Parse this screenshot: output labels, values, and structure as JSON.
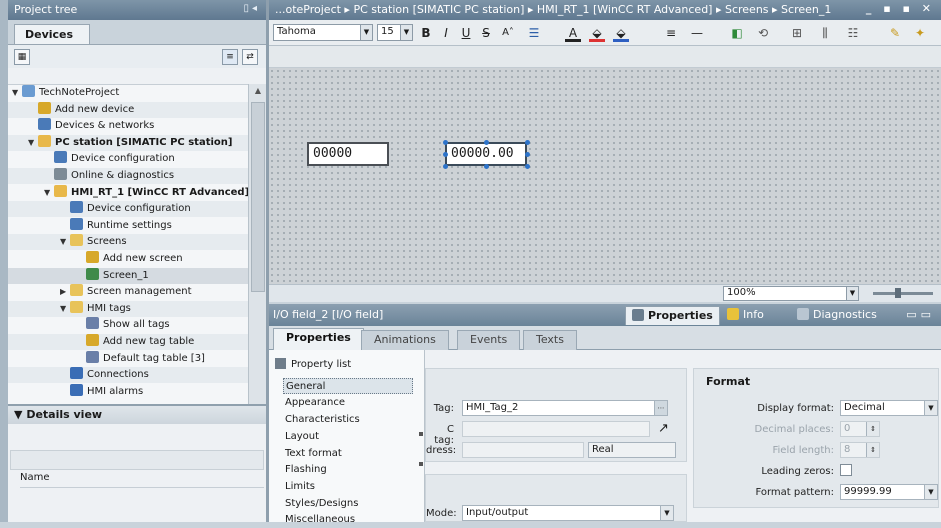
{
  "project_tree": {
    "title": "Project tree",
    "tab": "Devices",
    "items": [
      {
        "label": "TechNoteProject",
        "indent": 0,
        "toggle": "▼",
        "icon_color": "#6a9bd1"
      },
      {
        "label": "Add new device",
        "indent": 1,
        "toggle": "",
        "icon_color": "#d7a82a"
      },
      {
        "label": "Devices & networks",
        "indent": 1,
        "toggle": "",
        "icon_color": "#4a7ab8"
      },
      {
        "label": "PC station [SIMATIC PC station]",
        "indent": 1,
        "toggle": "▼",
        "icon_color": "#e8b84a"
      },
      {
        "label": "Device configuration",
        "indent": 2,
        "toggle": "",
        "icon_color": "#4a7ab8"
      },
      {
        "label": "Online & diagnostics",
        "indent": 2,
        "toggle": "",
        "icon_color": "#7d8b96"
      },
      {
        "label": "HMI_RT_1 [WinCC RT Advanced]",
        "indent": 2,
        "toggle": "▼",
        "icon_color": "#e8b84a"
      },
      {
        "label": "Device configuration",
        "indent": 3,
        "toggle": "",
        "icon_color": "#4a7ab8"
      },
      {
        "label": "Runtime settings",
        "indent": 3,
        "toggle": "",
        "icon_color": "#4a7ab8"
      },
      {
        "label": "Screens",
        "indent": 3,
        "toggle": "▼",
        "icon_color": "#e8c35a"
      },
      {
        "label": "Add new screen",
        "indent": 4,
        "toggle": "",
        "icon_color": "#d7a82a"
      },
      {
        "label": "Screen_1",
        "indent": 4,
        "toggle": "",
        "icon_color": "#3f8a4a"
      },
      {
        "label": "Screen management",
        "indent": 3,
        "toggle": "▶",
        "icon_color": "#e8c35a"
      },
      {
        "label": "HMI tags",
        "indent": 3,
        "toggle": "▼",
        "icon_color": "#e8c35a"
      },
      {
        "label": "Show all tags",
        "indent": 4,
        "toggle": "",
        "icon_color": "#6a7fa8"
      },
      {
        "label": "Add new tag table",
        "indent": 4,
        "toggle": "",
        "icon_color": "#d7a82a"
      },
      {
        "label": "Default tag table [3]",
        "indent": 4,
        "toggle": "",
        "icon_color": "#6a7fa8"
      },
      {
        "label": "Connections",
        "indent": 3,
        "toggle": "",
        "icon_color": "#3a6db5"
      },
      {
        "label": "HMI alarms",
        "indent": 3,
        "toggle": "",
        "icon_color": "#3a6db5"
      }
    ]
  },
  "details_view": {
    "title": "Details view",
    "column_name": "Name"
  },
  "breadcrumb": {
    "text": "...oteProject  ▸  PC station [SIMATIC PC station]  ▸  HMI_RT_1 [WinCC RT Advanced]  ▸  Screens  ▸  Screen_1",
    "win_buttons": "_ ▪ ▪ ✕"
  },
  "format_toolbar": {
    "font": "Tahoma",
    "size": "15"
  },
  "canvas": {
    "field1_value": "00000",
    "field2_value": "00000.00"
  },
  "zoom": {
    "value": "100%"
  },
  "inspector": {
    "object_title": "I/O field_2 [I/O field]",
    "tabs": [
      "Properties",
      "Info",
      "Diagnostics"
    ],
    "property_tabs": [
      "Properties",
      "Animations",
      "Events",
      "Texts"
    ],
    "property_list_title": "Property list",
    "property_list": [
      "General",
      "Appearance",
      "Characteristics",
      "Layout",
      "Text format",
      "Flashing",
      "Limits",
      "Styles/Designs",
      "Miscellaneous"
    ],
    "process": {
      "tag_label": "Tag:",
      "tag_value": "HMI_Tag_2",
      "plc_tag_label": "C tag:",
      "address_label": "dress:",
      "type_value": "Real",
      "mode_label": "Mode:",
      "mode_value": "Input/output"
    },
    "format": {
      "title": "Format",
      "display_format_label": "Display format:",
      "display_format_value": "Decimal",
      "decimal_places_label": "Decimal places:",
      "decimal_places_value": "0",
      "field_length_label": "Field length:",
      "field_length_value": "8",
      "leading_zeros_label": "Leading zeros:",
      "format_pattern_label": "Format pattern:",
      "format_pattern_value": "99999.99"
    }
  }
}
